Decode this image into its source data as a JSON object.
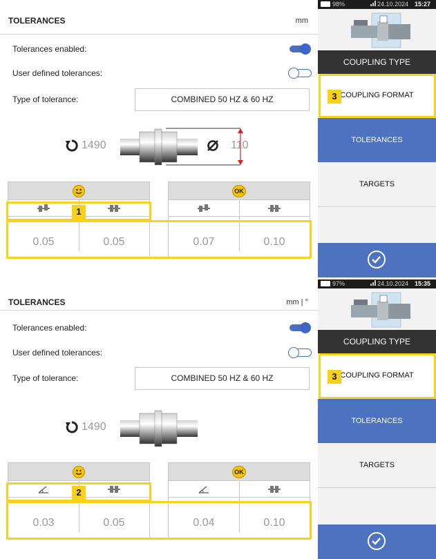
{
  "panels": [
    {
      "header": {
        "title": "TOLERANCES",
        "unit": "mm"
      },
      "tolerances_enabled_label": "Tolerances enabled:",
      "user_defined_label": "User defined tolerances:",
      "type_label": "Type of tolerance:",
      "type_value": "COMBINED 50 HZ & 60 HZ",
      "rpm": "1490",
      "diameter": "110",
      "table": {
        "good": {
          "values": [
            "0.05",
            "0.05"
          ]
        },
        "ok": {
          "label": "OK",
          "values": [
            "0.07",
            "0.10"
          ]
        }
      },
      "callout": "1",
      "sidebar": {
        "status": {
          "battery": "98%",
          "date": "24.10.2024",
          "time": "15:27"
        },
        "coupling_type": "COUPLING TYPE",
        "coupling_format": "COUPLING FORMAT",
        "coupling_format_callout": "3",
        "tolerances": "TOLERANCES",
        "targets": "TARGETS"
      }
    },
    {
      "header": {
        "title": "TOLERANCES",
        "unit": "mm | °"
      },
      "tolerances_enabled_label": "Tolerances enabled:",
      "user_defined_label": "User defined tolerances:",
      "type_label": "Type of tolerance:",
      "type_value": "COMBINED 50 HZ & 60 HZ",
      "rpm": "1490",
      "table": {
        "good": {
          "values": [
            "0.03",
            "0.05"
          ]
        },
        "ok": {
          "label": "OK",
          "values": [
            "0.04",
            "0.10"
          ]
        }
      },
      "callout": "2",
      "sidebar": {
        "status": {
          "battery": "97%",
          "date": "24.10.2024",
          "time": "15:35"
        },
        "coupling_type": "COUPLING TYPE",
        "coupling_format": "COUPLING FORMAT",
        "coupling_format_callout": "3",
        "tolerances": "TOLERANCES",
        "targets": "TARGETS"
      }
    }
  ],
  "colors": {
    "accent_blue": "#4d73c0",
    "highlight_yellow": "#f7d11a",
    "dark_bar": "#333333"
  },
  "icons": [
    "rotation-icon",
    "diameter-icon",
    "smiley-icon",
    "ok-icon",
    "offset-icon",
    "gap-icon",
    "angle-icon",
    "checkmark-icon",
    "battery-icon",
    "signal-icon"
  ]
}
